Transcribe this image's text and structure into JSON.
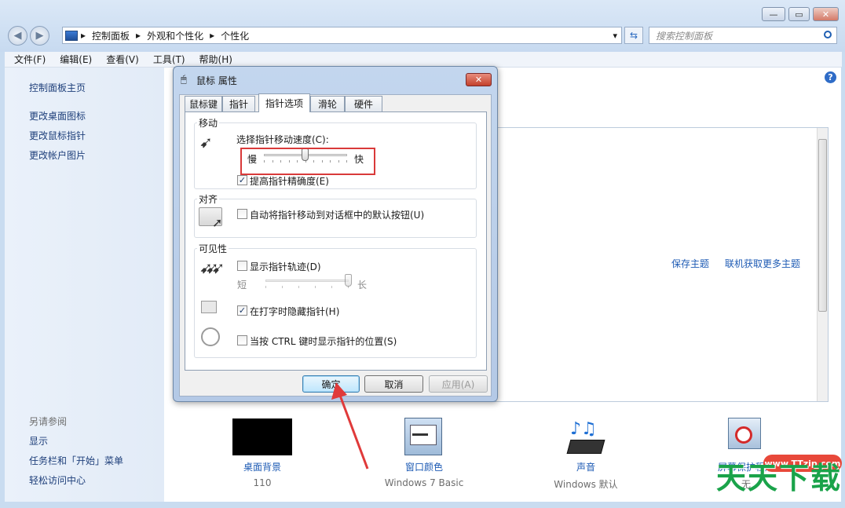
{
  "window": {
    "minimize": "—",
    "maximize": "▭",
    "close": "✕",
    "back": "◀",
    "forward": "▶",
    "refresh": "⇆"
  },
  "address": {
    "root_arrow": "▸",
    "crumbs": [
      "控制面板",
      "外观和个性化",
      "个性化"
    ],
    "sep": "▸",
    "dropdown": "▾"
  },
  "search": {
    "placeholder": "搜索控制面板",
    "icon": "search-icon"
  },
  "menubar": [
    "文件(F)",
    "编辑(E)",
    "查看(V)",
    "工具(T)",
    "帮助(H)"
  ],
  "leftpane": {
    "home": "控制面板主页",
    "links": [
      "更改桌面图标",
      "更改鼠标指针",
      "更改帐户图片"
    ],
    "see_also_title": "另请参阅",
    "see_also": [
      "显示",
      "任务栏和「开始」菜单",
      "轻松访问中心"
    ]
  },
  "main": {
    "help": "?",
    "save_theme": "保存主题",
    "get_more_themes": "联机获取更多主题",
    "bottom_items": [
      {
        "label": "桌面背景",
        "sub": "110"
      },
      {
        "label": "窗口颜色",
        "sub": "Windows 7 Basic"
      },
      {
        "label": "声音",
        "sub": "Windows 默认"
      },
      {
        "label": "屏幕保护程序",
        "sub": "无"
      }
    ]
  },
  "dialog": {
    "title": "鼠标 属性",
    "close": "✕",
    "tabs": [
      "鼠标键",
      "指针",
      "指针选项",
      "滑轮",
      "硬件"
    ],
    "active_tab": 2,
    "motion": {
      "group_label": "移动",
      "speed_label": "选择指针移动速度(C):",
      "slow": "慢",
      "fast": "快",
      "speed_value_fraction": 0.5,
      "precision_label": "提高指针精确度(E)",
      "precision_checked": "✓"
    },
    "snap": {
      "group_label": "对齐",
      "snap_label": "自动将指针移动到对话框中的默认按钮(U)",
      "snap_checked": ""
    },
    "visibility": {
      "group_label": "可见性",
      "trails_label": "显示指针轨迹(D)",
      "trails_checked": "",
      "short": "短",
      "long": "长",
      "trails_value_fraction": 1.0,
      "hide_label": "在打字时隐藏指针(H)",
      "hide_checked": "✓",
      "ctrl_label": "当按 CTRL 键时显示指针的位置(S)",
      "ctrl_checked": ""
    },
    "buttons": {
      "ok": "确定",
      "cancel": "取消",
      "apply": "应用(A)"
    }
  },
  "watermark": {
    "site": "www.TTzip.com",
    "brand": "天天下载"
  },
  "colors": {
    "accent_red": "#d93a3a",
    "link_blue": "#1e3f7a",
    "watermark_green": "#1aa34a"
  }
}
